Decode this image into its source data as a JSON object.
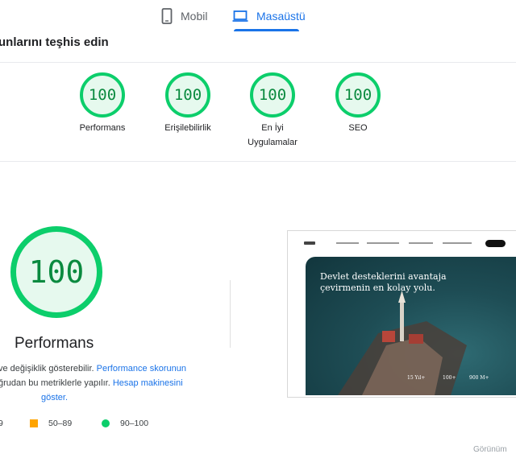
{
  "tabs": {
    "mobile": "Mobil",
    "desktop": "Masaüstü"
  },
  "heading": "unlarını teşhis edin",
  "categories": [
    {
      "score": "100",
      "label": "Performans"
    },
    {
      "score": "100",
      "label": "Erişilebilirlik"
    },
    {
      "score": "100",
      "label": "En İyi Uygulamalar"
    },
    {
      "score": "100",
      "label": "SEO"
    }
  ],
  "performance": {
    "score": "100",
    "title": "Performans",
    "desc1_text": "ve değişiklik gösterebilir. ",
    "desc1_link": "Performance skorunun",
    "desc2_text": "ğrudan bu metriklerle yapılır. ",
    "desc2_link": "Hesap makinesini",
    "desc3_link": "göster."
  },
  "legend": {
    "low": "9",
    "mid": "50–89",
    "high": "90–100"
  },
  "screenshot": {
    "hero_line1": "Devlet desteklerini avantaja",
    "hero_line2": "çevirmenin en kolay yolu.",
    "stat1": "15 Yıl+",
    "stat2": "100+",
    "stat3": "900 M+"
  },
  "corner_text": "Görünüm"
}
